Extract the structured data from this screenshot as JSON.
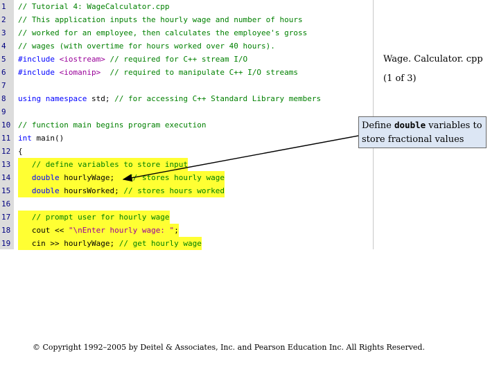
{
  "code": {
    "lines": [
      {
        "num": "1",
        "parts": [
          {
            "t": "// Tutorial 4: WageCalculator.cpp",
            "c": "cmt"
          }
        ]
      },
      {
        "num": "2",
        "parts": [
          {
            "t": "// This application inputs the hourly wage and number of hours",
            "c": "cmt"
          }
        ]
      },
      {
        "num": "3",
        "parts": [
          {
            "t": "// worked for an employee, then calculates the employee's gross",
            "c": "cmt"
          }
        ]
      },
      {
        "num": "4",
        "parts": [
          {
            "t": "// wages (with overtime for hours worked over 40 hours).",
            "c": "cmt"
          }
        ]
      },
      {
        "num": "5",
        "parts": [
          {
            "t": "#include ",
            "c": "pp"
          },
          {
            "t": "<iostream>",
            "c": "str"
          },
          {
            "t": " // required for C++ stream I/O",
            "c": "cmt"
          }
        ]
      },
      {
        "num": "6",
        "parts": [
          {
            "t": "#include ",
            "c": "pp"
          },
          {
            "t": "<iomanip>",
            "c": "str"
          },
          {
            "t": "  // required to manipulate C++ I/O streams",
            "c": "cmt"
          }
        ]
      },
      {
        "num": "7",
        "parts": []
      },
      {
        "num": "8",
        "parts": [
          {
            "t": "using namespace ",
            "c": "kw"
          },
          {
            "t": "std; ",
            "c": "txt"
          },
          {
            "t": "// for accessing C++ Standard Library members",
            "c": "cmt"
          }
        ]
      },
      {
        "num": "9",
        "parts": []
      },
      {
        "num": "10",
        "parts": [
          {
            "t": "// function main begins program execution",
            "c": "cmt"
          }
        ]
      },
      {
        "num": "11",
        "parts": [
          {
            "t": "int ",
            "c": "kw"
          },
          {
            "t": "main()",
            "c": "txt"
          }
        ]
      },
      {
        "num": "12",
        "parts": [
          {
            "t": "{",
            "c": "txt"
          }
        ]
      },
      {
        "num": "13",
        "hl": true,
        "parts": [
          {
            "t": "   // define variables to store input",
            "c": "cmt"
          }
        ]
      },
      {
        "num": "14",
        "hl": true,
        "parts": [
          {
            "t": "   double ",
            "c": "kw"
          },
          {
            "t": "hourlyWage;   ",
            "c": "txt"
          },
          {
            "t": "// stores hourly wage",
            "c": "cmt"
          }
        ]
      },
      {
        "num": "15",
        "hl": true,
        "parts": [
          {
            "t": "   double ",
            "c": "kw"
          },
          {
            "t": "hoursWorked; ",
            "c": "txt"
          },
          {
            "t": "// stores hours worked",
            "c": "cmt"
          }
        ]
      },
      {
        "num": "16",
        "parts": []
      },
      {
        "num": "17",
        "hl": true,
        "parts": [
          {
            "t": "   // prompt user for hourly wage",
            "c": "cmt"
          }
        ]
      },
      {
        "num": "18",
        "hl": true,
        "parts": [
          {
            "t": "   cout << ",
            "c": "txt"
          },
          {
            "t": "\"\\nEnter hourly wage: \"",
            "c": "str"
          },
          {
            "t": ";",
            "c": "txt"
          }
        ]
      },
      {
        "num": "19",
        "hl": true,
        "parts": [
          {
            "t": "   cin >> hourlyWage; ",
            "c": "txt"
          },
          {
            "t": "// get hourly wage",
            "c": "cmt"
          }
        ]
      }
    ]
  },
  "side": {
    "title": "Wage. Calculator. cpp",
    "subtitle": "(1 of 3)"
  },
  "callout": {
    "prefix": "Define ",
    "keyword": "double",
    "suffix": " variables to store fractional values"
  },
  "footer": {
    "copyright": "© Copyright 1992–2005 by Deitel & Associates, Inc. and Pearson Education Inc. All Rights Reserved."
  }
}
